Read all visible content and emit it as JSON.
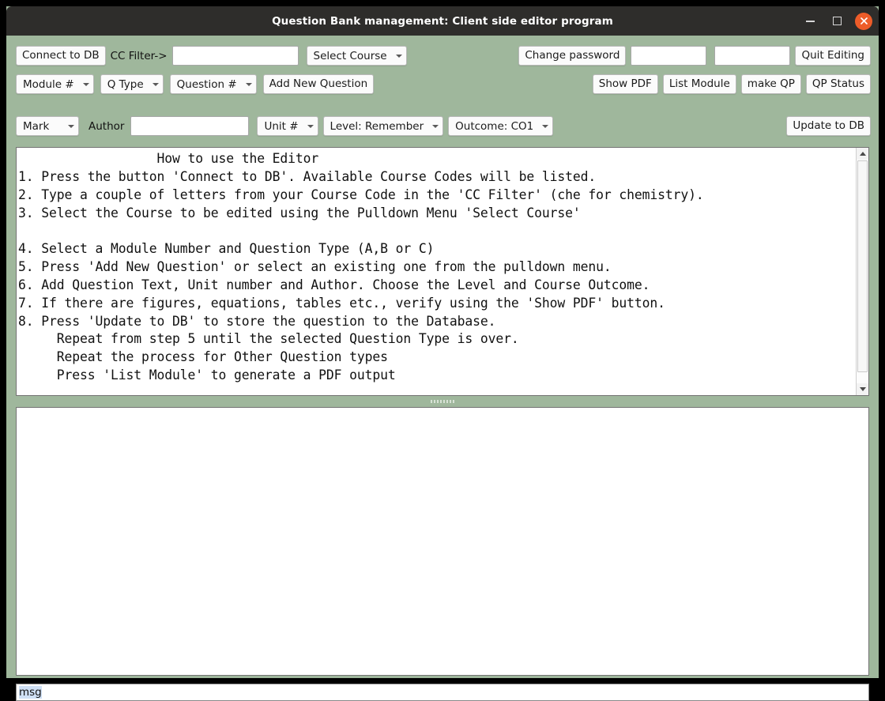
{
  "window": {
    "title": "Question Bank management: Client side editor program",
    "minimize_label": "minimize",
    "maximize_label": "maximize",
    "close_label": "close",
    "bg_color": "#9fb79c",
    "titlebar_color": "#2e2d2b",
    "close_color": "#ed5c29"
  },
  "toolbar_row1": {
    "connect_button": "Connect to DB",
    "cc_filter_label": "CC Filter->",
    "cc_filter_value": "",
    "cc_filter_placeholder": "",
    "select_course": "Select Course",
    "change_password_button": "Change password",
    "password_value": "",
    "password_confirm_value": "",
    "quit_button": "Quit Editing"
  },
  "toolbar_row2": {
    "module_combo": "Module #",
    "qtype_combo": "Q Type",
    "question_combo": "Question #",
    "add_question_button": "Add New Question",
    "show_pdf_button": "Show PDF",
    "list_module_button": "List Module",
    "make_qp_button": "make QP",
    "qp_status_button": "QP Status"
  },
  "toolbar_row3": {
    "mark_combo": "Mark",
    "author_label": "Author",
    "author_value": "",
    "unit_combo": "Unit #",
    "level_combo": "Level: Remember",
    "outcome_combo": "Outcome: CO1",
    "update_button": "Update to DB"
  },
  "editor": {
    "content": "                  How to use the Editor\n1. Press the button 'Connect to DB'. Available Course Codes will be listed.\n2. Type a couple of letters from your Course Code in the 'CC Filter' (che for chemistry).\n3. Select the Course to be edited using the Pulldown Menu 'Select Course'\n\n4. Select a Module Number and Question Type (A,B or C)\n5. Press 'Add New Question' or select an existing one from the pulldown menu.\n6. Add Question Text, Unit number and Author. Choose the Level and Course Outcome.\n7. If there are figures, equations, tables etc., verify using the 'Show PDF' button.\n8. Press 'Update to DB' to store the question to the Database.\n     Repeat from step 5 until the selected Question Type is over.\n     Repeat the process for Other Question types\n     Press 'List Module' to generate a PDF output",
    "scroll_up_icon": "triangle-up-icon",
    "scroll_down_icon": "triangle-down-icon"
  },
  "preview": {
    "content": ""
  },
  "statusbar": {
    "message": "msg"
  }
}
